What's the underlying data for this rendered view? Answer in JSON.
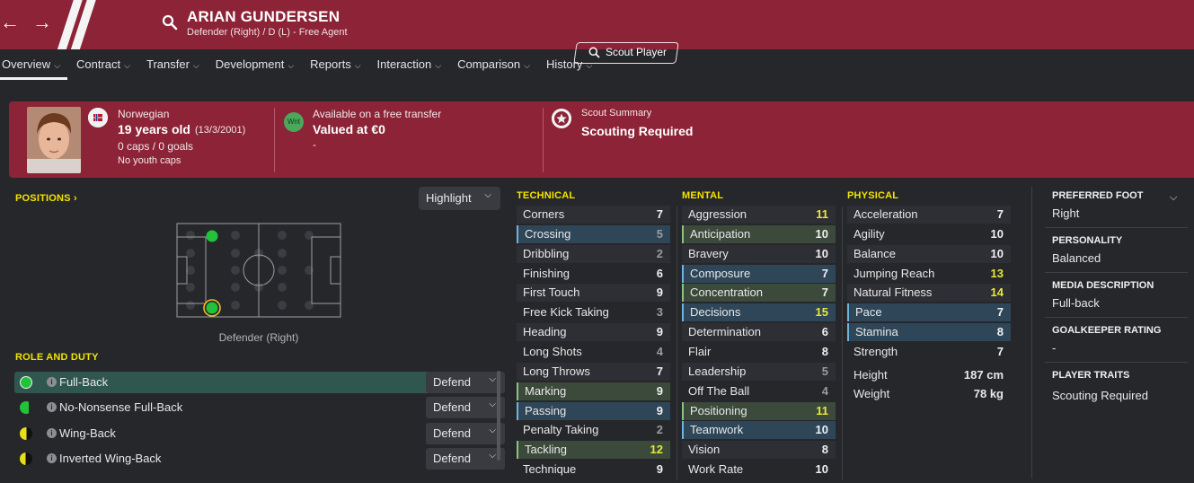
{
  "header": {
    "player_name": "ARIAN GUNDERSEN",
    "subtitle": "Defender (Right) / D (L) - Free Agent"
  },
  "tabs": [
    {
      "label": "Overview"
    },
    {
      "label": "Contract"
    },
    {
      "label": "Transfer"
    },
    {
      "label": "Development"
    },
    {
      "label": "Reports"
    },
    {
      "label": "Interaction"
    },
    {
      "label": "Comparison"
    },
    {
      "label": "History"
    }
  ],
  "banner": {
    "nationality": "Norwegian",
    "age": "19 years old",
    "dob": "(13/3/2001)",
    "caps_goals": "0 caps / 0 goals",
    "youth_caps": "No youth caps",
    "transfer_badge": "Wnt",
    "transfer_status": "Available on a free transfer",
    "value": "Valued at €0",
    "value_note": "-",
    "scout_summary_label": "Scout Summary",
    "scout_summary_value": "Scouting Required",
    "scout_button": "Scout Player"
  },
  "positions": {
    "title": "POSITIONS",
    "highlight_button": "Highlight",
    "caption": "Defender (Right)"
  },
  "roles": {
    "title": "ROLE AND DUTY",
    "items": [
      {
        "name": "Full-Back",
        "duty": "Defend"
      },
      {
        "name": "No-Nonsense Full-Back",
        "duty": "Defend"
      },
      {
        "name": "Wing-Back",
        "duty": "Defend"
      },
      {
        "name": "Inverted Wing-Back",
        "duty": "Defend"
      }
    ]
  },
  "technical": {
    "title": "TECHNICAL",
    "items": [
      {
        "name": "Corners",
        "value": "7"
      },
      {
        "name": "Crossing",
        "value": "5"
      },
      {
        "name": "Dribbling",
        "value": "2"
      },
      {
        "name": "Finishing",
        "value": "6"
      },
      {
        "name": "First Touch",
        "value": "9"
      },
      {
        "name": "Free Kick Taking",
        "value": "3"
      },
      {
        "name": "Heading",
        "value": "9"
      },
      {
        "name": "Long Shots",
        "value": "4"
      },
      {
        "name": "Long Throws",
        "value": "7"
      },
      {
        "name": "Marking",
        "value": "9"
      },
      {
        "name": "Passing",
        "value": "9"
      },
      {
        "name": "Penalty Taking",
        "value": "2"
      },
      {
        "name": "Tackling",
        "value": "12"
      },
      {
        "name": "Technique",
        "value": "9"
      }
    ]
  },
  "mental": {
    "title": "MENTAL",
    "items": [
      {
        "name": "Aggression",
        "value": "11"
      },
      {
        "name": "Anticipation",
        "value": "10"
      },
      {
        "name": "Bravery",
        "value": "10"
      },
      {
        "name": "Composure",
        "value": "7"
      },
      {
        "name": "Concentration",
        "value": "7"
      },
      {
        "name": "Decisions",
        "value": "15"
      },
      {
        "name": "Determination",
        "value": "6"
      },
      {
        "name": "Flair",
        "value": "8"
      },
      {
        "name": "Leadership",
        "value": "5"
      },
      {
        "name": "Off The Ball",
        "value": "4"
      },
      {
        "name": "Positioning",
        "value": "11"
      },
      {
        "name": "Teamwork",
        "value": "10"
      },
      {
        "name": "Vision",
        "value": "8"
      },
      {
        "name": "Work Rate",
        "value": "10"
      }
    ]
  },
  "physical": {
    "title": "PHYSICAL",
    "items": [
      {
        "name": "Acceleration",
        "value": "7"
      },
      {
        "name": "Agility",
        "value": "10"
      },
      {
        "name": "Balance",
        "value": "10"
      },
      {
        "name": "Jumping Reach",
        "value": "13"
      },
      {
        "name": "Natural Fitness",
        "value": "14"
      },
      {
        "name": "Pace",
        "value": "7"
      },
      {
        "name": "Stamina",
        "value": "8"
      },
      {
        "name": "Strength",
        "value": "7"
      }
    ],
    "height_label": "Height",
    "height_value": "187 cm",
    "weight_label": "Weight",
    "weight_value": "78 kg"
  },
  "side_panel": {
    "preferred_foot_label": "PREFERRED FOOT",
    "preferred_foot": "Right",
    "personality_label": "PERSONALITY",
    "personality": "Balanced",
    "media_label": "MEDIA DESCRIPTION",
    "media": "Full-back",
    "gk_label": "GOALKEEPER RATING",
    "gk": "-",
    "traits_label": "PLAYER TRAITS",
    "traits": "Scouting Required"
  },
  "colors": {
    "header": "#8c2337",
    "background": "#26272b",
    "accent_yellow": "#f3e400",
    "position_green": "#22c33b"
  }
}
